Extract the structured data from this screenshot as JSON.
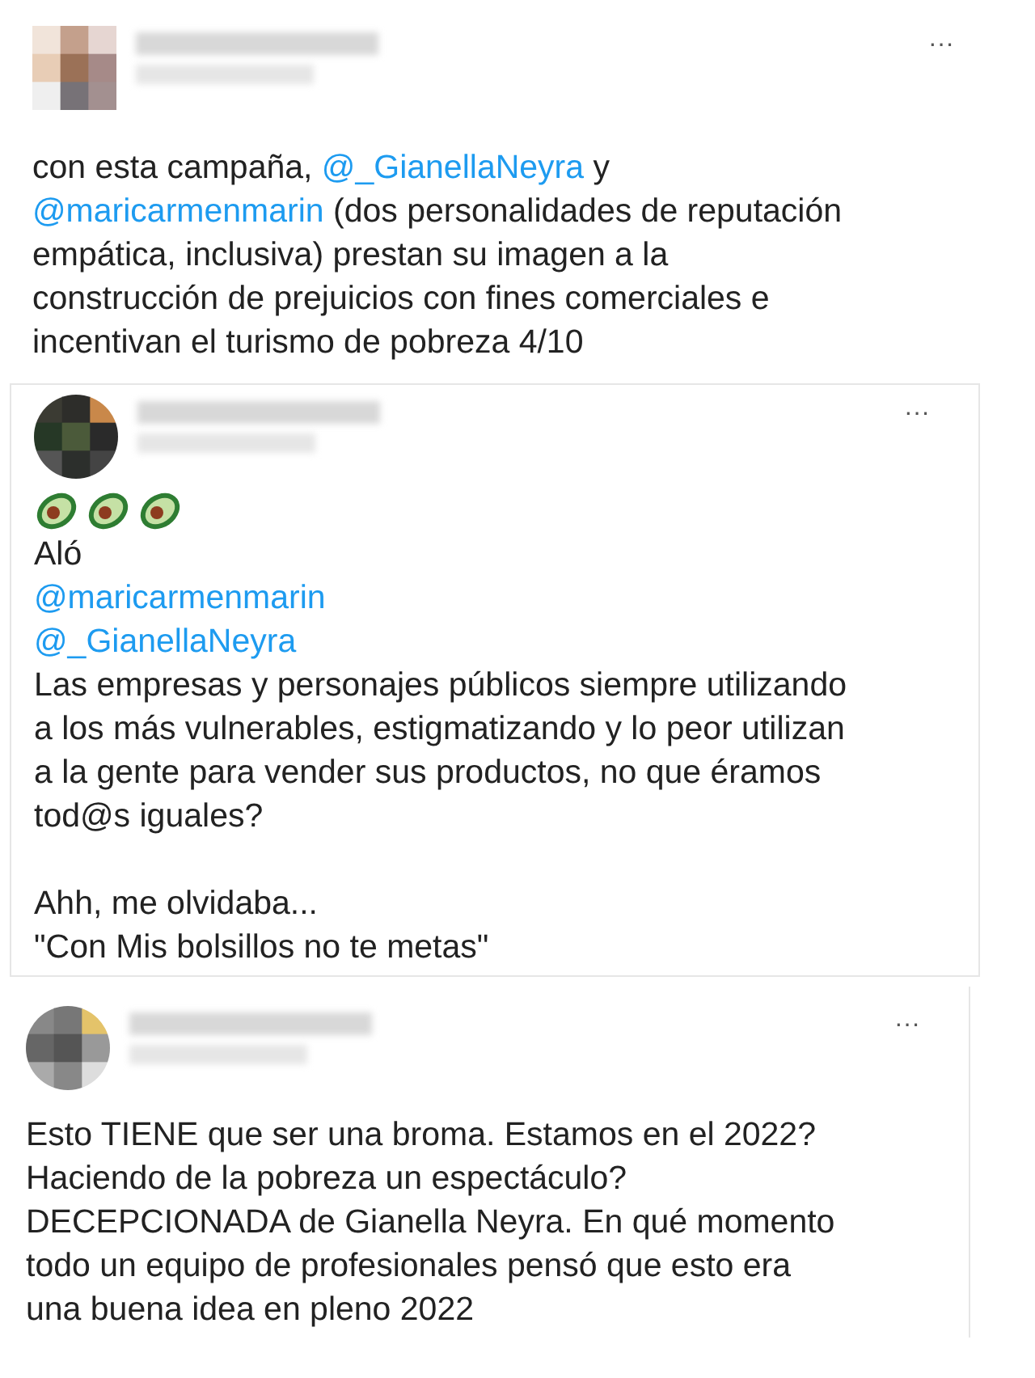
{
  "tweets": [
    {
      "paragraphs": [
        [
          [
            {
              "kind": "text",
              "text": "con esta campaña, "
            },
            {
              "kind": "mention",
              "text": "@_GianellaNeyra"
            },
            {
              "kind": "text",
              "text": " y"
            }
          ],
          [
            {
              "kind": "mention",
              "text": "@maricarmenmarin"
            },
            {
              "kind": "text",
              "text": " (dos personalidades de reputación"
            }
          ],
          [
            {
              "kind": "text",
              "text": "empática, inclusiva) prestan su imagen a la"
            }
          ],
          [
            {
              "kind": "text",
              "text": "construcción de prejuicios con fines comerciales e"
            }
          ],
          [
            {
              "kind": "text",
              "text": "incentivan el turismo de pobreza 4/10"
            }
          ]
        ]
      ],
      "menu": "···"
    },
    {
      "paragraphs": [
        [
          [
            {
              "kind": "avocado"
            },
            {
              "kind": "avocado"
            },
            {
              "kind": "avocado"
            }
          ],
          [
            {
              "kind": "text",
              "text": "Aló"
            }
          ],
          [
            {
              "kind": "mention",
              "text": "@maricarmenmarin"
            }
          ],
          [
            {
              "kind": "mention",
              "text": "@_GianellaNeyra"
            }
          ],
          [
            {
              "kind": "text",
              "text": "Las empresas y personajes públicos siempre utilizando"
            }
          ],
          [
            {
              "kind": "text",
              "text": "a los más vulnerables, estigmatizando y lo peor utilizan"
            }
          ],
          [
            {
              "kind": "text",
              "text": "a la gente para vender sus productos, no que éramos"
            }
          ],
          [
            {
              "kind": "text",
              "text": "tod@s iguales?"
            }
          ]
        ],
        [
          [
            {
              "kind": "text",
              "text": "Ahh, me olvidaba..."
            }
          ],
          [
            {
              "kind": "text",
              "text": "\"Con Mis bolsillos no te metas\""
            }
          ]
        ]
      ],
      "menu": "···"
    },
    {
      "paragraphs": [
        [
          [
            {
              "kind": "text",
              "text": "Esto TIENE que ser una broma. Estamos en el 2022?"
            }
          ],
          [
            {
              "kind": "text",
              "text": "Haciendo de la pobreza un espectáculo?"
            }
          ],
          [
            {
              "kind": "text",
              "text": "DECEPCIONADA de Gianella Neyra. En qué momento"
            }
          ],
          [
            {
              "kind": "text",
              "text": "todo un equipo de profesionales pensó que esto era"
            }
          ],
          [
            {
              "kind": "text",
              "text": "una buena idea en pleno 2022"
            }
          ]
        ]
      ],
      "menu": "···"
    }
  ]
}
